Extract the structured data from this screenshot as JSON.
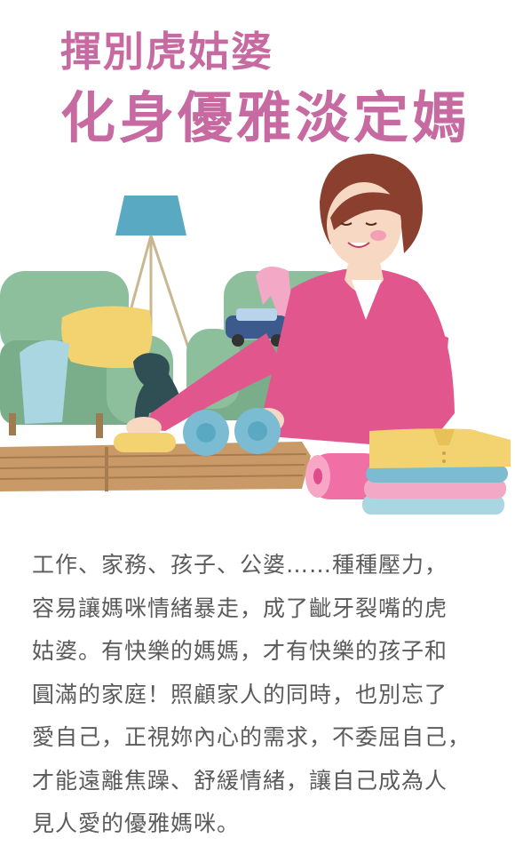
{
  "header": {
    "title_line1": "揮別虎姑婆",
    "title_line2": "化身優雅淡定媽"
  },
  "colors": {
    "title": "#c76aa1",
    "sofa": "#8dbf9d",
    "shirt": "#e2568e",
    "text": "#5b5b5b"
  },
  "article": {
    "body": "工作、家務、孩子、公婆……種種壓力，\n容易讓媽咪情緒暴走，成了齜牙裂嘴的虎\n姑婆。有快樂的媽媽，才有快樂的孩子和\n圓滿的家庭！照顧家人的同時，也別忘了\n愛自己，正視妳內心的需求，不委屈自己，\n才能遠離焦躁、舒緩情緒，讓自己成為人\n見人愛的優雅媽咪。"
  }
}
